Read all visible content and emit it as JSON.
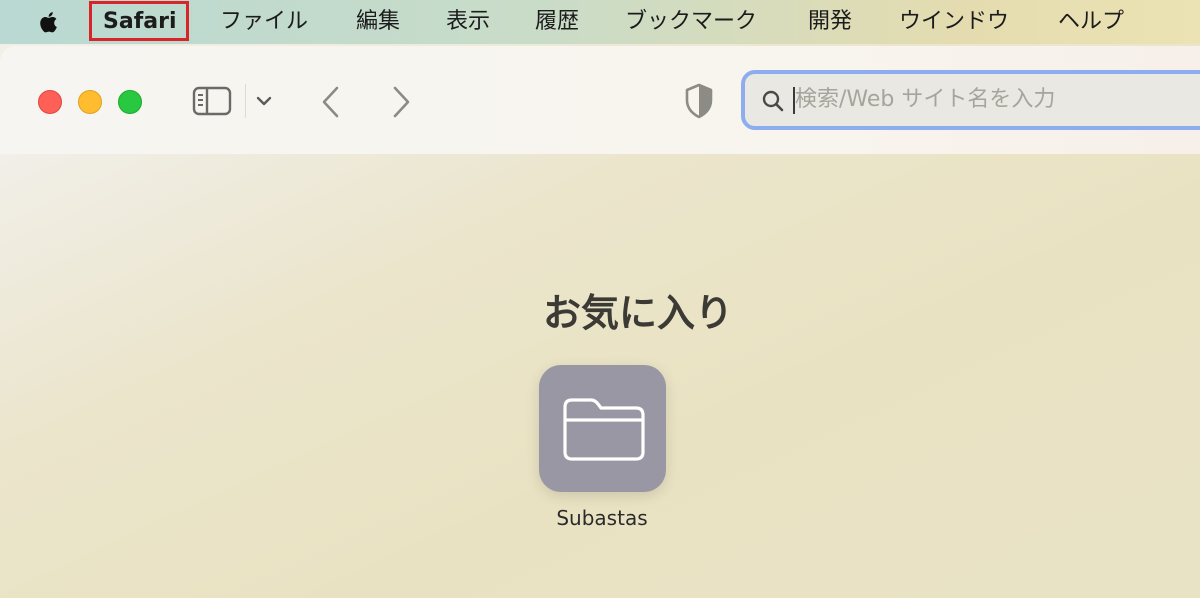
{
  "menubar": {
    "apple_icon": "apple-logo-icon",
    "app_name": "Safari",
    "items": [
      "ファイル",
      "編集",
      "表示",
      "履歴",
      "ブックマーク",
      "開発",
      "ウインドウ",
      "ヘルプ"
    ],
    "highlight_color": "#d9252a"
  },
  "toolbar": {
    "traffic_lights": {
      "close": "#fe5f57",
      "minimize": "#febc2e",
      "zoom": "#28c840"
    },
    "icons": {
      "sidebar": "sidebar-toggle-icon",
      "tab_group_menu": "chevron-down-icon",
      "back": "chevron-left-icon",
      "forward": "chevron-right-icon",
      "privacy": "shield-icon",
      "search": "magnifying-glass-icon"
    },
    "search_placeholder": "検索/Web サイト名を入力",
    "search_focus_color": "#8eadef"
  },
  "favorites": {
    "title": "お気に入り",
    "items": [
      {
        "label": "Subastas",
        "icon": "folder-icon",
        "tile_color": "#9897a3"
      }
    ]
  }
}
